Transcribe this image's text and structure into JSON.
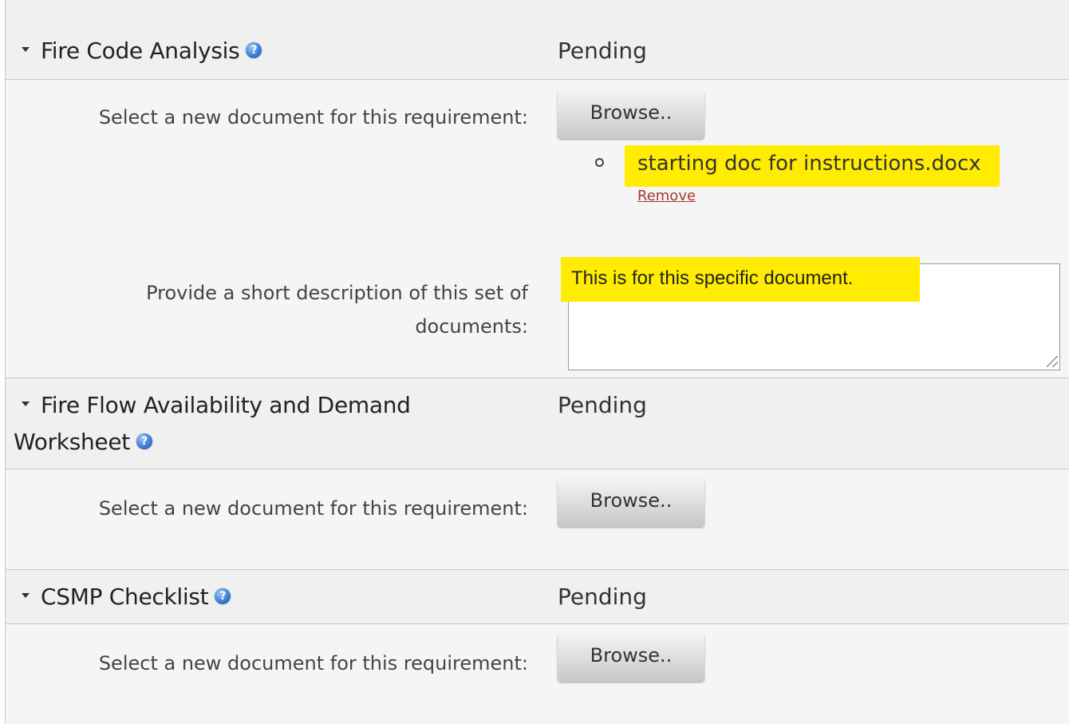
{
  "requirements": [
    {
      "title": "Fire Code Analysis",
      "status": "Pending",
      "select_label": "Select a new document for this requirement:",
      "browse_label": "Browse..",
      "file": {
        "name": "starting doc for instructions.docx",
        "remove_label": "Remove"
      },
      "description_label_line1": "Provide a short description of this set of",
      "description_label_line2": "documents:",
      "description_value": "This is for this specific document."
    },
    {
      "title_line1": "Fire Flow Availability and Demand",
      "title_line2": "Worksheet",
      "status": "Pending",
      "select_label": "Select a new document for this requirement:",
      "browse_label": "Browse.."
    },
    {
      "title": "CSMP Checklist",
      "status": "Pending",
      "select_label": "Select a new document for this requirement:",
      "browse_label": "Browse.."
    }
  ],
  "help_icon_glyph": "?",
  "highlight_color": "#ffec00",
  "remove_link_color": "#a33a2a",
  "icons": {
    "expand": "caret-down-icon",
    "help": "help-question-icon"
  }
}
